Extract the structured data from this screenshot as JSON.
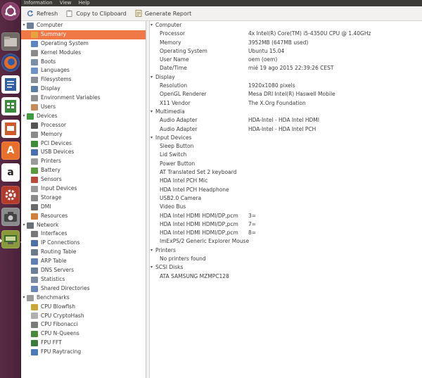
{
  "menubar": {
    "items": [
      "Information",
      "View",
      "Help"
    ]
  },
  "toolbar": {
    "refresh": "Refresh",
    "copy": "Copy to Clipboard",
    "report": "Generate Report"
  },
  "launcher": {
    "icons": [
      "ubuntu-dash-icon",
      "files-icon",
      "firefox-icon",
      "writer-icon",
      "calc-icon",
      "impress-icon",
      "software-center-icon",
      "amazon-icon",
      "system-settings-icon",
      "screenshot-icon",
      "hardinfo-icon"
    ]
  },
  "tree": [
    {
      "label": "Computer",
      "level": 1,
      "expander": "▾",
      "icon": "computer-icon",
      "color": "#6d7f99"
    },
    {
      "label": "Summary",
      "level": 2,
      "icon": "summary-icon",
      "color": "#e8a33e",
      "selected": true
    },
    {
      "label": "Operating System",
      "level": 2,
      "icon": "os-icon",
      "color": "#5f84c2"
    },
    {
      "label": "Kernel Modules",
      "level": 2,
      "icon": "modules-icon",
      "color": "#8a8a8a"
    },
    {
      "label": "Boots",
      "level": 2,
      "icon": "boots-icon",
      "color": "#7a8fa8"
    },
    {
      "label": "Languages",
      "level": 2,
      "icon": "languages-icon",
      "color": "#7090c8"
    },
    {
      "label": "Filesystems",
      "level": 2,
      "icon": "filesystems-icon",
      "color": "#8a8f95"
    },
    {
      "label": "Display",
      "level": 2,
      "icon": "display-icon",
      "color": "#5d7ca6"
    },
    {
      "label": "Environment Variables",
      "level": 2,
      "icon": "environment-icon",
      "color": "#8f8f8f"
    },
    {
      "label": "Users",
      "level": 2,
      "icon": "users-icon",
      "color": "#c78b5a"
    },
    {
      "label": "Devices",
      "level": 1,
      "expander": "▾",
      "icon": "devices-icon",
      "color": "#3f9b3f"
    },
    {
      "label": "Processor",
      "level": 2,
      "icon": "processor-icon",
      "color": "#555555"
    },
    {
      "label": "Memory",
      "level": 2,
      "icon": "memory-icon",
      "color": "#8a8a8a"
    },
    {
      "label": "PCI Devices",
      "level": 2,
      "icon": "pci-icon",
      "color": "#3c8c3c"
    },
    {
      "label": "USB Devices",
      "level": 2,
      "icon": "usb-icon",
      "color": "#4b6fae"
    },
    {
      "label": "Printers",
      "level": 2,
      "icon": "printer-icon",
      "color": "#9a9a9a"
    },
    {
      "label": "Battery",
      "level": 2,
      "icon": "battery-icon",
      "color": "#5a9a3c"
    },
    {
      "label": "Sensors",
      "level": 2,
      "icon": "sensors-icon",
      "color": "#b94a3a"
    },
    {
      "label": "Input Devices",
      "level": 2,
      "icon": "input-devices-icon",
      "color": "#9a9a9a"
    },
    {
      "label": "Storage",
      "level": 2,
      "icon": "storage-icon",
      "color": "#8a8a8a"
    },
    {
      "label": "DMI",
      "level": 2,
      "icon": "dmi-icon",
      "color": "#6a6a6a"
    },
    {
      "label": "Resources",
      "level": 2,
      "icon": "resources-icon",
      "color": "#d0803a"
    },
    {
      "label": "Network",
      "level": 1,
      "expander": "▾",
      "icon": "network-icon",
      "color": "#6a6f78"
    },
    {
      "label": "Interfaces",
      "level": 2,
      "icon": "interfaces-icon",
      "color": "#777777"
    },
    {
      "label": "IP Connections",
      "level": 2,
      "icon": "ip-connections-icon",
      "color": "#4e6fa8"
    },
    {
      "label": "Routing Table",
      "level": 2,
      "icon": "routing-table-icon",
      "color": "#6b7b8c"
    },
    {
      "label": "ARP Table",
      "level": 2,
      "icon": "arp-table-icon",
      "color": "#5f80b0"
    },
    {
      "label": "DNS Servers",
      "level": 2,
      "icon": "dns-servers-icon",
      "color": "#6a7f95"
    },
    {
      "label": "Statistics",
      "level": 2,
      "icon": "statistics-icon",
      "color": "#7a8aa0"
    },
    {
      "label": "Shared Directories",
      "level": 2,
      "icon": "shared-directories-icon",
      "color": "#6a86b8"
    },
    {
      "label": "Benchmarks",
      "level": 1,
      "expander": "▾",
      "icon": "benchmarks-icon",
      "color": "#9a9a9a"
    },
    {
      "label": "CPU Blowfish",
      "level": 2,
      "icon": "blowfish-icon",
      "color": "#c9a63a"
    },
    {
      "label": "CPU CryptoHash",
      "level": 2,
      "icon": "cryptohash-icon",
      "color": "#b0b0b0"
    },
    {
      "label": "CPU Fibonacci",
      "level": 2,
      "icon": "fibonacci-icon",
      "color": "#7a7a7a"
    },
    {
      "label": "CPU N-Queens",
      "level": 2,
      "icon": "nqueens-icon",
      "color": "#4b8a3a"
    },
    {
      "label": "FPU FFT",
      "level": 2,
      "icon": "fft-icon",
      "color": "#3a7a3a"
    },
    {
      "label": "FPU Raytracing",
      "level": 2,
      "icon": "raytracing-icon",
      "color": "#4a7ab8"
    }
  ],
  "details": [
    {
      "type": "section",
      "key": "Computer"
    },
    {
      "type": "item",
      "key": "Processor",
      "value": "4x Intel(R) Core(TM) i5-4350U CPU @ 1.40GHz"
    },
    {
      "type": "item",
      "key": "Memory",
      "value": "3952MB (647MB used)"
    },
    {
      "type": "item",
      "key": "Operating System",
      "value": "Ubuntu 15.04"
    },
    {
      "type": "item",
      "key": "User Name",
      "value": "oem (oem)"
    },
    {
      "type": "item",
      "key": "Date/Time",
      "value": "mié 19 ago 2015 22:39:26 CEST"
    },
    {
      "type": "section",
      "key": "Display"
    },
    {
      "type": "item",
      "key": "Resolution",
      "value": "1920x1080 pixels"
    },
    {
      "type": "item",
      "key": "OpenGL Renderer",
      "value": "Mesa DRI Intel(R) Haswell Mobile"
    },
    {
      "type": "item",
      "key": "X11 Vendor",
      "value": "The X.Org Foundation"
    },
    {
      "type": "section",
      "key": "Multimedia"
    },
    {
      "type": "item",
      "key": "Audio Adapter",
      "value": "HDA-Intel - HDA Intel HDMI"
    },
    {
      "type": "item",
      "key": "Audio Adapter",
      "value": "HDA-Intel - HDA Intel PCH"
    },
    {
      "type": "section",
      "key": "Input Devices"
    },
    {
      "type": "item",
      "key": "Sleep Button",
      "value": ""
    },
    {
      "type": "item",
      "key": "Lid Switch",
      "value": ""
    },
    {
      "type": "item",
      "key": "Power Button",
      "value": ""
    },
    {
      "type": "item",
      "key": "AT Translated Set 2 keyboard",
      "value": ""
    },
    {
      "type": "item",
      "key": "HDA Intel PCH Mic",
      "value": ""
    },
    {
      "type": "item",
      "key": "HDA Intel PCH Headphone",
      "value": ""
    },
    {
      "type": "item",
      "key": "USB2.0 Camera",
      "value": ""
    },
    {
      "type": "item",
      "key": "Video Bus",
      "value": ""
    },
    {
      "type": "item",
      "key": "HDA Intel HDMI HDMI/DP,pcm",
      "value": "3="
    },
    {
      "type": "item",
      "key": "HDA Intel HDMI HDMI/DP,pcm",
      "value": "7="
    },
    {
      "type": "item",
      "key": "HDA Intel HDMI HDMI/DP,pcm",
      "value": "8="
    },
    {
      "type": "item",
      "key": "ImExPS/2 Generic Explorer Mouse",
      "value": ""
    },
    {
      "type": "section",
      "key": "Printers"
    },
    {
      "type": "item",
      "key": "No printers found",
      "value": ""
    },
    {
      "type": "section",
      "key": "SCSI Disks"
    },
    {
      "type": "item",
      "key": "ATA SAMSUNG MZMPC128",
      "value": ""
    }
  ]
}
